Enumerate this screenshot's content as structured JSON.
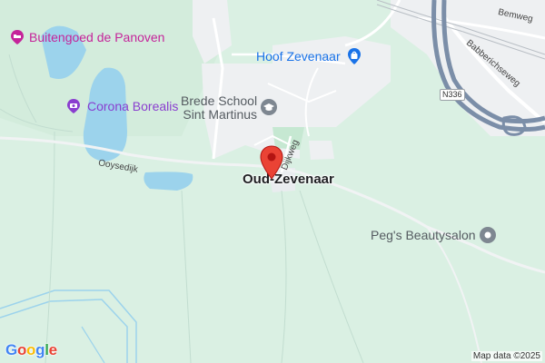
{
  "map": {
    "places": {
      "buitengoed": "Buitengoed de Panoven",
      "corona": "Corona Borealis",
      "school": "Brede School\nSint Martinus",
      "hoof": "Hoof Zevenaar",
      "town": "Oud-Zevenaar",
      "pegs": "Peg's Beautysalon"
    },
    "roads": {
      "oysedijk": "Ooysedijk",
      "dijkweg": "Dijkweg",
      "babberichseweg": "Babberichseweg",
      "bemweg": "Bemweg",
      "n336": "N336"
    },
    "attribution": "Map data ©2025",
    "logo": [
      "G",
      "o",
      "o",
      "g",
      "l",
      "e"
    ],
    "colors": {
      "land": "#daf0e3",
      "water": "#9cd3ec",
      "built": "#eef0f2",
      "marker": "#ea4335",
      "poi_pink": "#c5249a",
      "poi_purple": "#8a3ecf",
      "poi_blue": "#1a73e8",
      "highway": "#7b8ea8"
    },
    "icons": {
      "buitengoed": "hotel-bed-icon",
      "corona": "camera-icon",
      "school": "school-cap-icon",
      "hoof": "shopping-bag-icon",
      "pegs": "beauty-salon-icon",
      "marker": "location-pin-icon"
    }
  }
}
